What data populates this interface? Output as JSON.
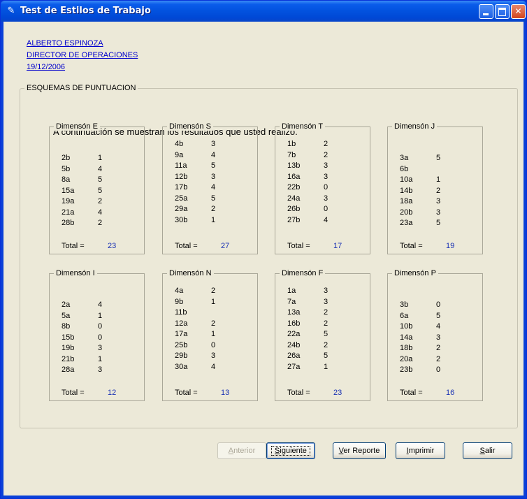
{
  "window": {
    "title": "Test de Estilos de Trabajo"
  },
  "header": {
    "name": "ALBERTO ESPINOZA",
    "position": "DIRECTOR DE OPERACIONES",
    "date": "19/12/2006"
  },
  "section": {
    "legend": "ESQUEMAS DE PUNTUACION",
    "intro": "A continuación se muestran los resultados que usted realizo."
  },
  "total_label": "Total =",
  "dimensions": [
    {
      "title": "Dimensón E",
      "rows": [
        [
          "2b",
          "1"
        ],
        [
          "5b",
          "4"
        ],
        [
          "8a",
          "5"
        ],
        [
          "15a",
          "5"
        ],
        [
          "19a",
          "2"
        ],
        [
          "21a",
          "4"
        ],
        [
          "28b",
          "2"
        ]
      ],
      "total": "23"
    },
    {
      "title": "Dimensón S",
      "rows": [
        [
          "4b",
          "3"
        ],
        [
          "9a",
          "4"
        ],
        [
          "11a",
          "5"
        ],
        [
          "12b",
          "3"
        ],
        [
          "17b",
          "4"
        ],
        [
          "25a",
          "5"
        ],
        [
          "29a",
          "2"
        ],
        [
          "30b",
          "1"
        ]
      ],
      "total": "27"
    },
    {
      "title": "Dimensón T",
      "rows": [
        [
          "1b",
          "2"
        ],
        [
          "7b",
          "2"
        ],
        [
          "13b",
          "3"
        ],
        [
          "16a",
          "3"
        ],
        [
          "22b",
          "0"
        ],
        [
          "24a",
          "3"
        ],
        [
          "26b",
          "0"
        ],
        [
          "27b",
          "4"
        ]
      ],
      "total": "17"
    },
    {
      "title": "Dimensón J",
      "rows": [
        [
          "3a",
          "5"
        ],
        [
          "6b",
          ""
        ],
        [
          "10a",
          "1"
        ],
        [
          "14b",
          "2"
        ],
        [
          "18a",
          "3"
        ],
        [
          "20b",
          "3"
        ],
        [
          "23a",
          "5"
        ]
      ],
      "total": "19"
    },
    {
      "title": "Dimensón I",
      "rows": [
        [
          "2a",
          "4"
        ],
        [
          "5a",
          "1"
        ],
        [
          "8b",
          "0"
        ],
        [
          "15b",
          "0"
        ],
        [
          "19b",
          "3"
        ],
        [
          "21b",
          "1"
        ],
        [
          "28a",
          "3"
        ]
      ],
      "total": "12"
    },
    {
      "title": "Dimensón N",
      "rows": [
        [
          "4a",
          "2"
        ],
        [
          "9b",
          "1"
        ],
        [
          "11b",
          ""
        ],
        [
          "12a",
          "2"
        ],
        [
          "17a",
          "1"
        ],
        [
          "25b",
          "0"
        ],
        [
          "29b",
          "3"
        ],
        [
          "30a",
          "4"
        ]
      ],
      "total": "13"
    },
    {
      "title": "Dimensón F",
      "rows": [
        [
          "1a",
          "3"
        ],
        [
          "7a",
          "3"
        ],
        [
          "13a",
          "2"
        ],
        [
          "16b",
          "2"
        ],
        [
          "22a",
          "5"
        ],
        [
          "24b",
          "2"
        ],
        [
          "26a",
          "5"
        ],
        [
          "27a",
          "1"
        ]
      ],
      "total": "23"
    },
    {
      "title": "Dimensón P",
      "rows": [
        [
          "3b",
          "0"
        ],
        [
          "6a",
          "5"
        ],
        [
          "10b",
          "4"
        ],
        [
          "14a",
          "3"
        ],
        [
          "18b",
          "2"
        ],
        [
          "20a",
          "2"
        ],
        [
          "23b",
          "0"
        ]
      ],
      "total": "16"
    }
  ],
  "buttons": {
    "anterior": {
      "mn": "A",
      "rest": "nterior"
    },
    "siguiente": {
      "mn": "S",
      "rest": "iguiente"
    },
    "reporte": {
      "mn": "V",
      "rest": "er Reporte"
    },
    "imprimir": {
      "mn": "I",
      "rest": "mprimir"
    },
    "salir": {
      "mn": "S",
      "rest": "alir"
    }
  },
  "colors": {
    "title_bar": "#0252de",
    "client_bg": "#ece9d8",
    "link": "#0000cc",
    "total_value": "#1a32b4"
  },
  "icons": {
    "app": "pen-icon",
    "minimize": "minimize-icon",
    "maximize": "maximize-icon",
    "close": "close-icon"
  }
}
